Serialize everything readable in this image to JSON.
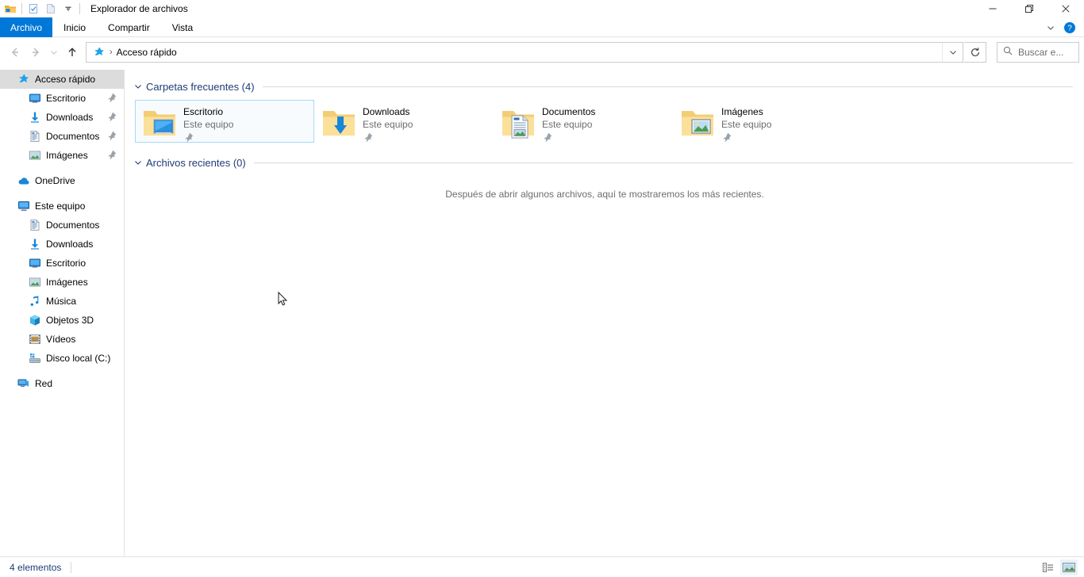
{
  "window": {
    "title": "Explorador de archivos",
    "quick_access_toolbar": [
      {
        "name": "folder-icon",
        "label": "Propiedades de carpeta"
      },
      {
        "name": "properties-icon",
        "label": "Propiedades"
      },
      {
        "name": "new-folder-icon",
        "label": "Nueva carpeta"
      },
      {
        "name": "chevron-down-icon",
        "label": "Personalizar barra de herramientas de acceso rápido"
      }
    ],
    "controls": [
      {
        "name": "minimize-button",
        "glyph": "minimize"
      },
      {
        "name": "maximize-button",
        "glyph": "maximize"
      },
      {
        "name": "close-button",
        "glyph": "close"
      }
    ]
  },
  "ribbon": {
    "tabs": [
      {
        "label": "Archivo",
        "active": true
      },
      {
        "label": "Inicio",
        "active": false
      },
      {
        "label": "Compartir",
        "active": false
      },
      {
        "label": "Vista",
        "active": false
      }
    ],
    "right_buttons": [
      {
        "name": "ribbon-expand-icon",
        "label": "Expandir la cinta"
      },
      {
        "name": "help-icon",
        "label": "Ayuda"
      }
    ]
  },
  "navbar": {
    "back": "Atrás",
    "forward": "Adelante",
    "recent": "Ubicaciones recientes",
    "up": "Subir un nivel",
    "breadcrumb": {
      "icon": "quick-access-star-icon",
      "separator": "›",
      "path": "Acceso rápido"
    },
    "address_dropdown": "Versiones anteriores",
    "refresh": "Actualizar",
    "search": {
      "placeholder": "Buscar e...",
      "icon": "search-icon"
    }
  },
  "sidebar": {
    "items": [
      {
        "label": "Acceso rápido",
        "icon": "quick-access-star-icon",
        "indent": 0,
        "selected": true,
        "pinned": false
      },
      {
        "label": "Escritorio",
        "icon": "desktop-icon",
        "indent": 1,
        "selected": false,
        "pinned": true
      },
      {
        "label": "Downloads",
        "icon": "downloads-icon",
        "indent": 1,
        "selected": false,
        "pinned": true
      },
      {
        "label": "Documentos",
        "icon": "documents-icon",
        "indent": 1,
        "selected": false,
        "pinned": true
      },
      {
        "label": "Imágenes",
        "icon": "pictures-icon",
        "indent": 1,
        "selected": false,
        "pinned": true
      },
      {
        "gap": true
      },
      {
        "label": "OneDrive",
        "icon": "onedrive-cloud-icon",
        "indent": 0,
        "selected": false,
        "pinned": false
      },
      {
        "gap": true
      },
      {
        "label": "Este equipo",
        "icon": "this-pc-icon",
        "indent": 0,
        "selected": false,
        "pinned": false
      },
      {
        "label": "Documentos",
        "icon": "documents-icon",
        "indent": 1,
        "selected": false,
        "pinned": false
      },
      {
        "label": "Downloads",
        "icon": "downloads-icon",
        "indent": 1,
        "selected": false,
        "pinned": false
      },
      {
        "label": "Escritorio",
        "icon": "desktop-icon",
        "indent": 1,
        "selected": false,
        "pinned": false
      },
      {
        "label": "Imágenes",
        "icon": "pictures-icon",
        "indent": 1,
        "selected": false,
        "pinned": false
      },
      {
        "label": "Música",
        "icon": "music-note-icon",
        "indent": 1,
        "selected": false,
        "pinned": false
      },
      {
        "label": "Objetos 3D",
        "icon": "objects-3d-icon",
        "indent": 1,
        "selected": false,
        "pinned": false
      },
      {
        "label": "Vídeos",
        "icon": "videos-icon",
        "indent": 1,
        "selected": false,
        "pinned": false
      },
      {
        "label": "Disco local (C:)",
        "icon": "hard-drive-icon",
        "indent": 1,
        "selected": false,
        "pinned": false
      },
      {
        "gap": true
      },
      {
        "label": "Red",
        "icon": "network-icon",
        "indent": 0,
        "selected": false,
        "pinned": false
      }
    ]
  },
  "main": {
    "groups": [
      {
        "id": "frequent-folders",
        "title": "Carpetas frecuentes (4)",
        "expanded": true,
        "items": [
          {
            "name": "Escritorio",
            "location": "Este equipo",
            "icon": "folder-desktop-icon",
            "pinned": true,
            "selected": true
          },
          {
            "name": "Downloads",
            "location": "Este equipo",
            "icon": "folder-downloads-icon",
            "pinned": true,
            "selected": false
          },
          {
            "name": "Documentos",
            "location": "Este equipo",
            "icon": "folder-documents-icon",
            "pinned": true,
            "selected": false
          },
          {
            "name": "Imágenes",
            "location": "Este equipo",
            "icon": "folder-pictures-icon",
            "pinned": true,
            "selected": false
          }
        ]
      },
      {
        "id": "recent-files",
        "title": "Archivos recientes (0)",
        "expanded": true,
        "empty_message": "Después de abrir algunos archivos, aquí te mostraremos los más recientes."
      }
    ]
  },
  "statusbar": {
    "item_count": "4 elementos",
    "views": [
      {
        "name": "details-view-button",
        "active": false
      },
      {
        "name": "large-icons-view-button",
        "active": true
      }
    ]
  },
  "colors": {
    "accent": "#0078d7",
    "group_header": "#1d3c76",
    "selection_border": "#a6d8f5",
    "selection_fill": "#f7fbfe",
    "sidebar_selected": "#dcdcdc",
    "muted_text": "#6d6d6d"
  }
}
